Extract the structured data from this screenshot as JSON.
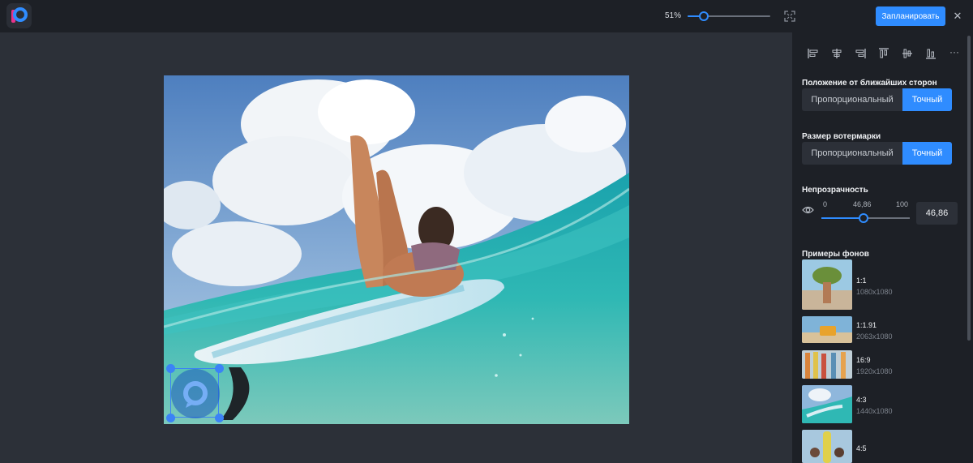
{
  "topbar": {
    "zoom_label": "51%",
    "zoom_value": 0.18,
    "schedule_label": "Запланировать",
    "close_glyph": "✕"
  },
  "panel": {
    "align_icons": [
      "align-left-icon",
      "align-center-horizontal-icon",
      "align-right-icon",
      "align-top-icon",
      "align-center-vertical-icon",
      "align-bottom-icon",
      "more-icon"
    ],
    "more_glyph": "···",
    "position": {
      "title": "Положение от ближайших сторон",
      "options": [
        "Пропорциональный",
        "Точный"
      ],
      "selected": "Точный"
    },
    "size": {
      "title": "Размер вотермарки",
      "options": [
        "Пропорциональный",
        "Точный"
      ],
      "selected": "Точный"
    },
    "opacity": {
      "title": "Непрозрачность",
      "min_label": "0",
      "value_label": "46,86",
      "max_label": "100",
      "value": 46.86,
      "input_value": "46,86"
    },
    "backgrounds": {
      "title": "Примеры фонов",
      "items": [
        {
          "ratio": "1:1",
          "size": "1080x1080"
        },
        {
          "ratio": "1:1.91",
          "size": "2063x1080"
        },
        {
          "ratio": "16:9",
          "size": "1920x1080"
        },
        {
          "ratio": "4:3",
          "size": "1440x1080"
        },
        {
          "ratio": "4:5",
          "size": ""
        }
      ]
    }
  },
  "colors": {
    "accent": "#2f8cff",
    "panel_bg": "#1d2026",
    "canvas_bg": "#2c3038"
  }
}
